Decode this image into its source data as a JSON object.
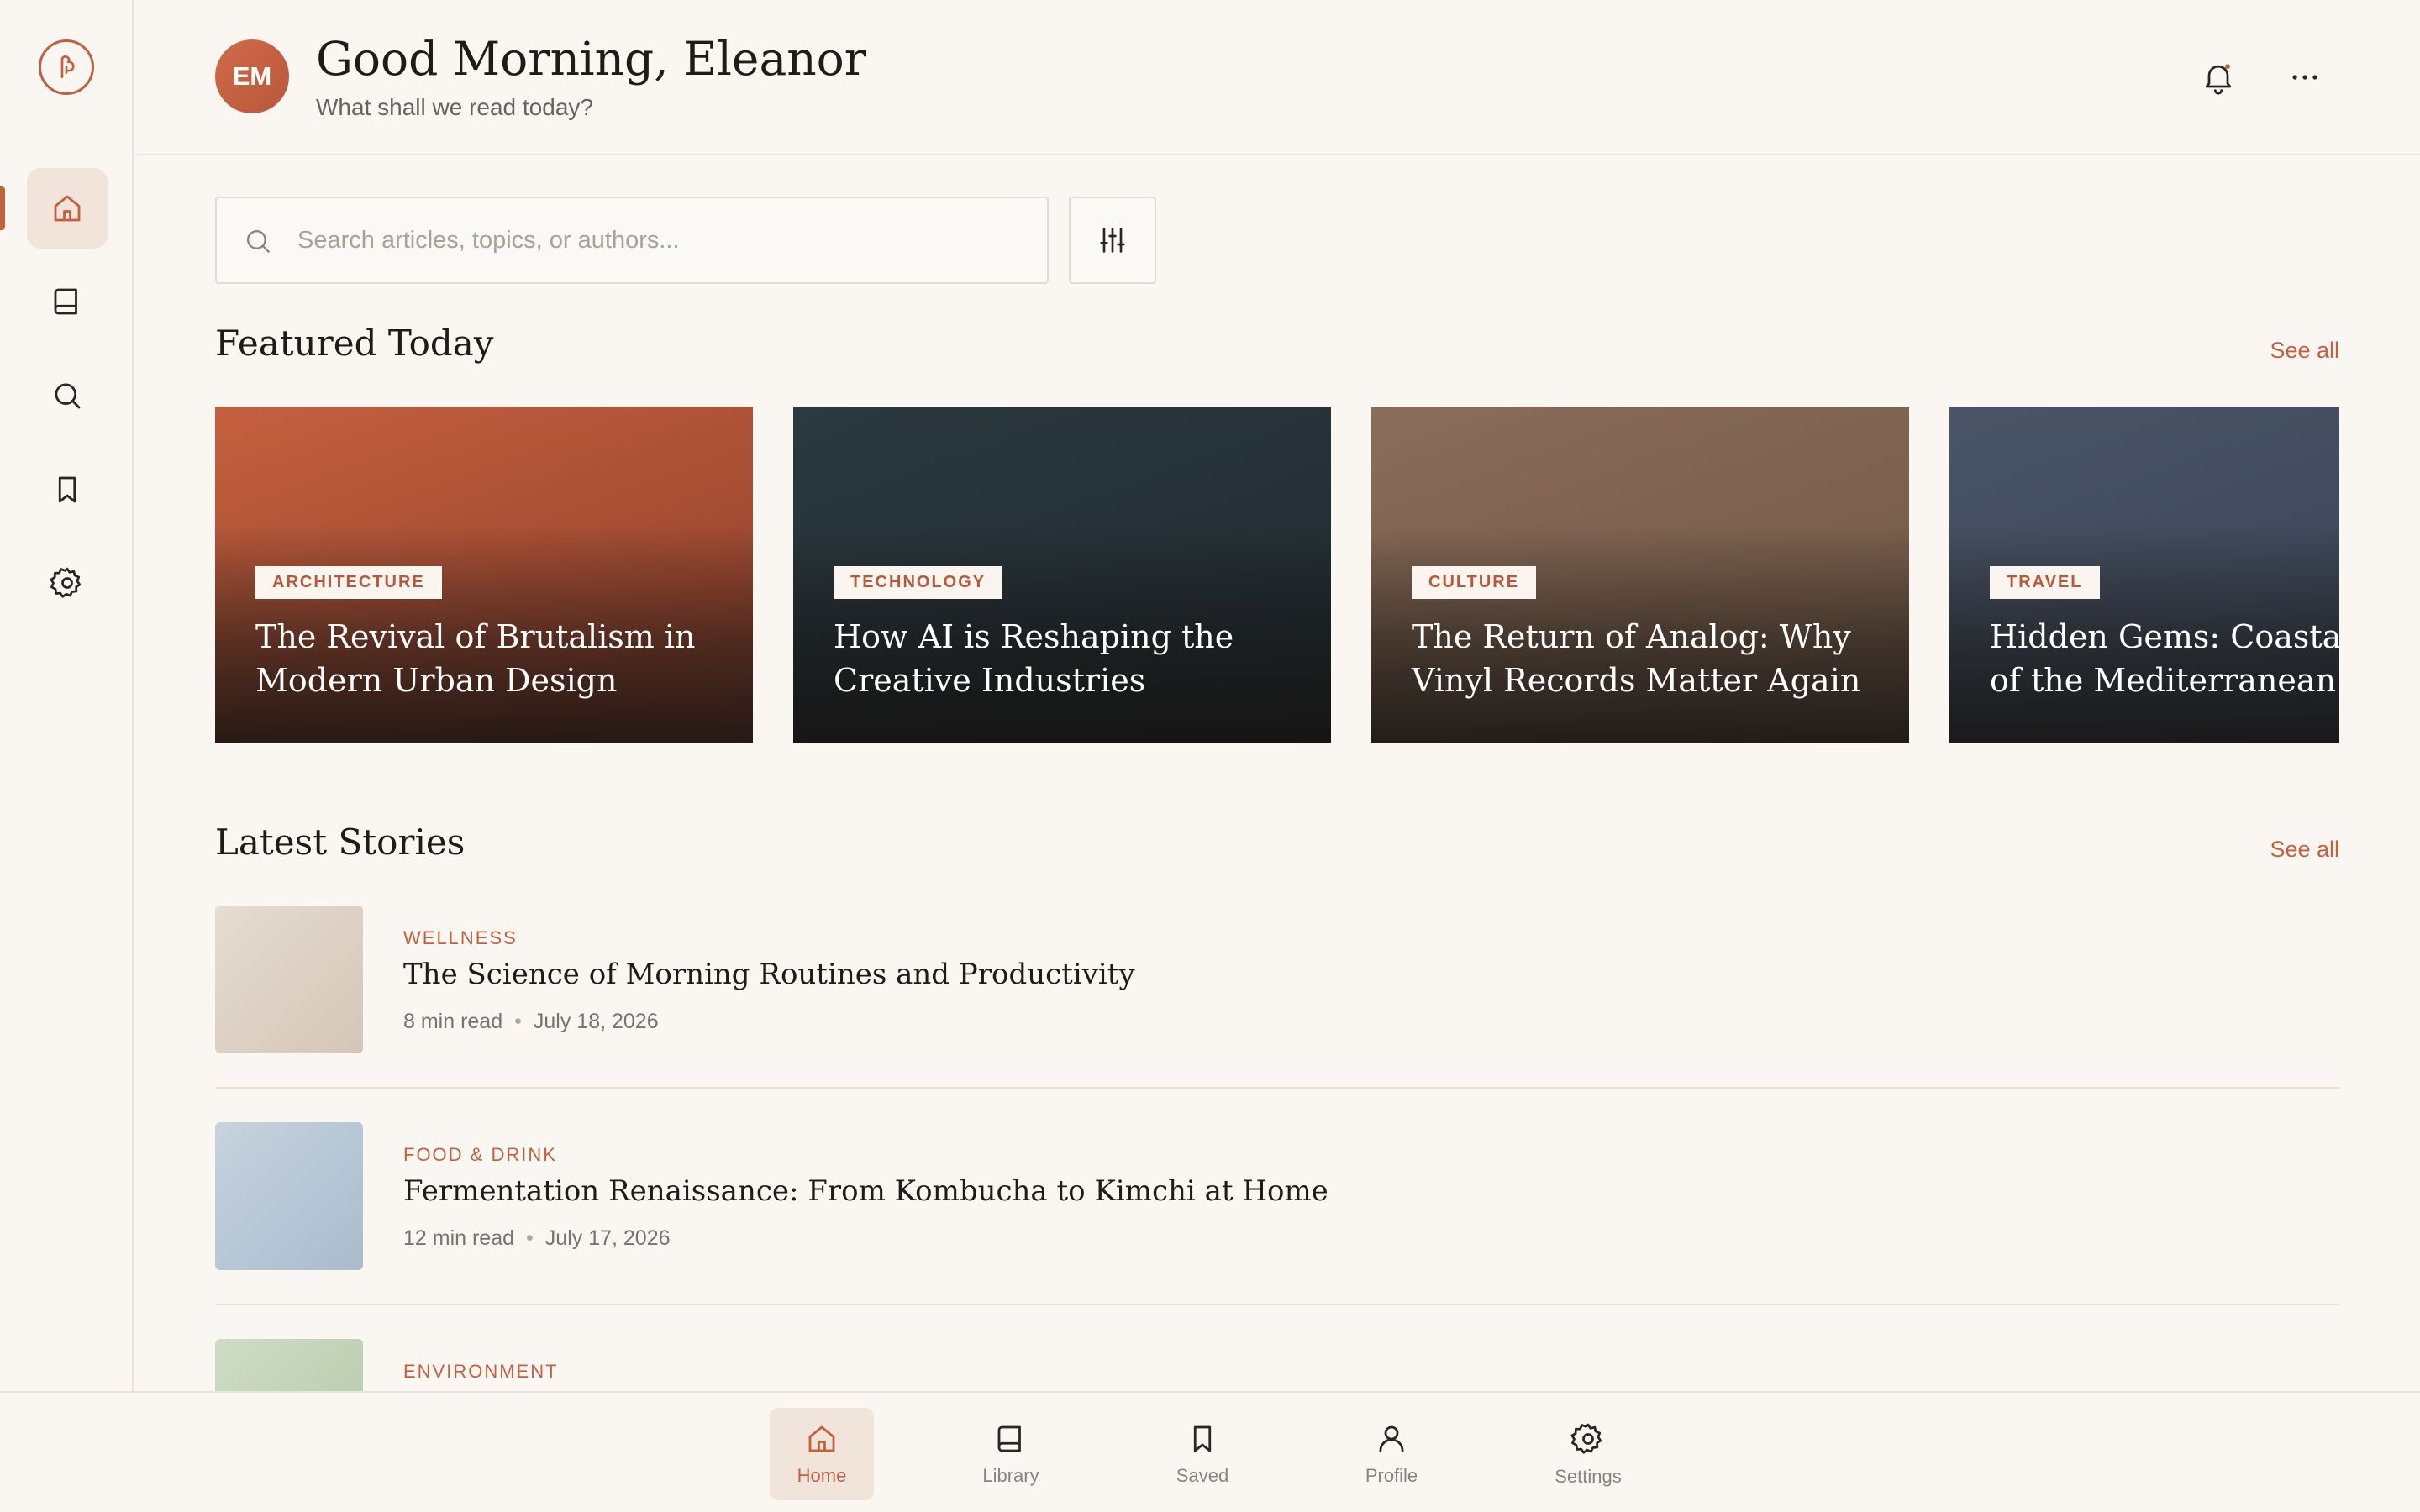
{
  "header": {
    "avatar_initials": "EM",
    "greeting": "Good Morning, Eleanor",
    "subtitle": "What shall we read today?"
  },
  "search": {
    "placeholder": "Search articles, topics, or authors..."
  },
  "sidebar": {
    "items": [
      {
        "icon": "home-icon",
        "active": true
      },
      {
        "icon": "book-icon",
        "active": false
      },
      {
        "icon": "search-icon",
        "active": false
      },
      {
        "icon": "bookmark-icon",
        "active": false
      },
      {
        "icon": "gear-icon",
        "active": false
      }
    ]
  },
  "featured": {
    "title": "Featured Today",
    "see_all": "See all",
    "cards": [
      {
        "tag": "ARCHITECTURE",
        "title_line1": "The Revival of Brutalism in",
        "title_line2": "Modern Urban Design",
        "color": "#b9573a"
      },
      {
        "tag": "TECHNOLOGY",
        "title_line1": "How AI is Reshaping the",
        "title_line2": "Creative Industries",
        "color": "#263238"
      },
      {
        "tag": "CULTURE",
        "title_line1": "The Return of Analog: Why",
        "title_line2": "Vinyl Records Matter Again",
        "color": "#7f6553"
      },
      {
        "tag": "TRAVEL",
        "title_line1": "Hidden Gems: Coastal Towns",
        "title_line2": "of the Mediterranean",
        "color": "#424e60"
      }
    ]
  },
  "latest": {
    "title": "Latest Stories",
    "see_all": "See all",
    "stories": [
      {
        "category": "WELLNESS",
        "title": "The Science of Morning Routines and Productivity",
        "read_time": "8 min read",
        "date": "July 18, 2026"
      },
      {
        "category": "FOOD & DRINK",
        "title": "Fermentation Renaissance: From Kombucha to Kimchi at Home",
        "read_time": "12 min read",
        "date": "July 17, 2026"
      },
      {
        "category": "ENVIRONMENT",
        "title": "",
        "read_time": "",
        "date": ""
      }
    ]
  },
  "bottom_nav": {
    "items": [
      {
        "label": "Home",
        "icon": "home-icon",
        "active": true
      },
      {
        "label": "Library",
        "icon": "book-icon",
        "active": false
      },
      {
        "label": "Saved",
        "icon": "bookmark-icon",
        "active": false
      },
      {
        "label": "Profile",
        "icon": "user-icon",
        "active": false
      },
      {
        "label": "Settings",
        "icon": "gear-icon",
        "active": false
      }
    ]
  },
  "colors": {
    "accent": "#c4603e",
    "background": "#faf7f3"
  }
}
